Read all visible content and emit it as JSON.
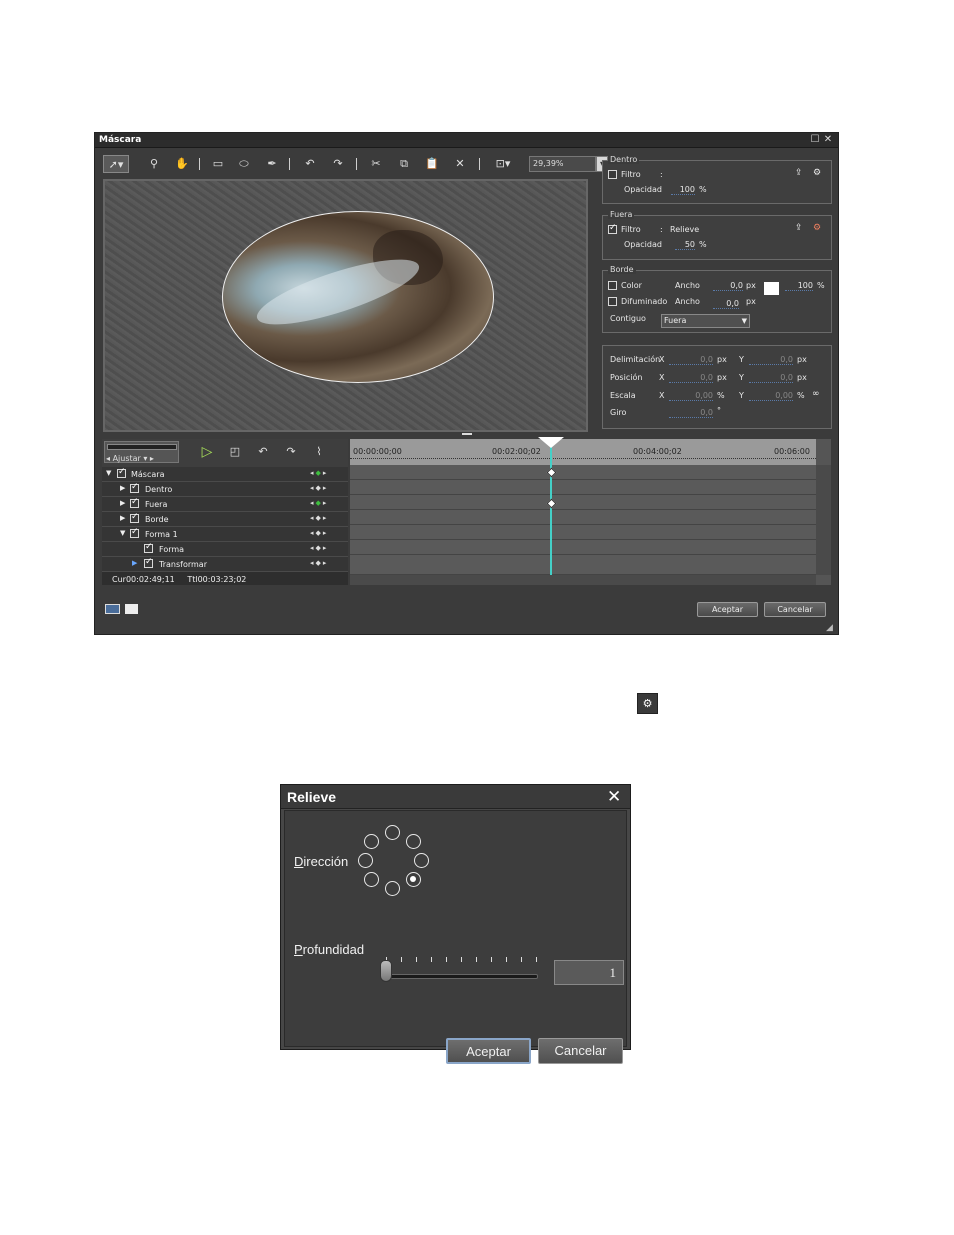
{
  "mascara": {
    "title": "Máscara",
    "zoom": "29,39%",
    "dentro": {
      "legend": "Dentro",
      "filtro_label": "Filtro",
      "filtro_sep": ":",
      "filtro_value": "",
      "filtro_checked": false,
      "opacidad_label": "Opacidad",
      "opacidad_value": "100",
      "opacidad_unit": "%"
    },
    "fuera": {
      "legend": "Fuera",
      "filtro_label": "Filtro",
      "filtro_sep": ":",
      "filtro_value": "Relieve",
      "filtro_checked": true,
      "opacidad_label": "Opacidad",
      "opacidad_value": "50",
      "opacidad_unit": "%"
    },
    "borde": {
      "legend": "Borde",
      "color_label": "Color",
      "ancho_label": "Ancho",
      "color_ancho_value": "0,0",
      "unit_px": "px",
      "color_opacity_value": "100",
      "unit_pct": "%",
      "difuminado_label": "Difuminado",
      "difuminado_ancho_value": "0,0",
      "contiguo_label": "Contiguo",
      "contiguo_value": "Fuera"
    },
    "transform": {
      "delimitacion_label": "Delimitación",
      "posicion_label": "Posición",
      "escala_label": "Escala",
      "giro_label": "Giro",
      "x_label": "X",
      "y_label": "Y",
      "delim_x": "0,0",
      "delim_y": "0,0",
      "pos_x": "0,0",
      "pos_y": "0,0",
      "esc_x": "0,00",
      "esc_y": "0,00",
      "giro": "0,0",
      "unit_px": "px",
      "unit_pct": "%",
      "unit_deg": "°"
    },
    "timeline": {
      "ajustar": "Ajustar",
      "ticks": [
        "00:00:00;00",
        "00:02:00;02",
        "00:04:00;02",
        "00:06:00"
      ],
      "tracks": [
        {
          "label": "Máscara",
          "expanded": true
        },
        {
          "label": "Dentro",
          "expanded": false
        },
        {
          "label": "Fuera",
          "expanded": false
        },
        {
          "label": "Borde",
          "expanded": false
        },
        {
          "label": "Forma 1",
          "expanded": true
        },
        {
          "label": "Forma",
          "expanded": false
        },
        {
          "label": "Transformar",
          "expanded": false
        }
      ],
      "cur_label": "Cur",
      "cur_value": "00:02:49;11",
      "ttl_label": "Ttl",
      "ttl_value": "00:03:23;02"
    },
    "ok_label": "Aceptar",
    "cancel_label": "Cancelar"
  },
  "relieve": {
    "title": "Relieve",
    "direccion_label": "Dirección",
    "direccion_accesskey": "D",
    "profundidad_label": "Profundidad",
    "profundidad_accesskey": "P",
    "profundidad_value": "1",
    "direction_selected": "bottom-right",
    "ok_label": "Aceptar",
    "cancel_label": "Cancelar"
  },
  "colors": {
    "window_bg": "#3b3b3b",
    "playhead": "#44d0c8",
    "keyframe_active": "#3fbf3f",
    "dialog_focus": "#8aa6c9"
  }
}
